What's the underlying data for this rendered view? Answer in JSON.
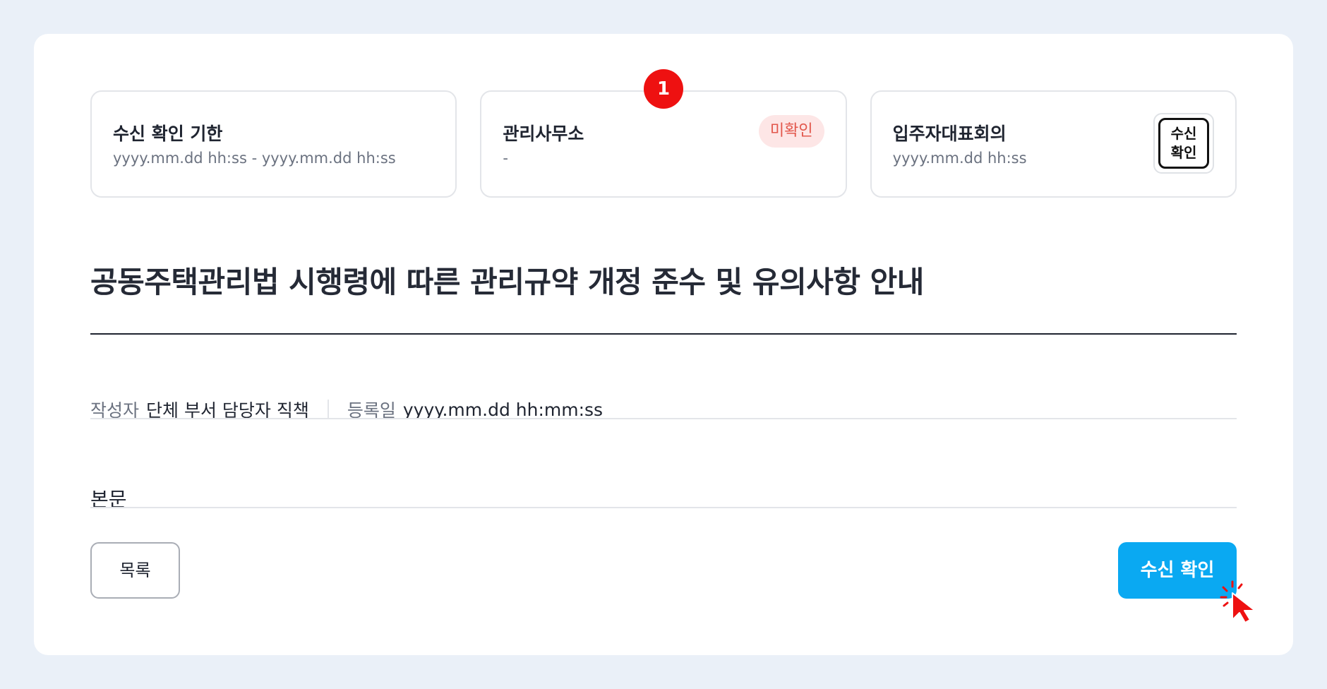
{
  "cards": [
    {
      "title": "수신 확인 기한",
      "subtitle": "yyyy.mm.dd hh:ss  -  yyyy.mm.dd hh:ss"
    },
    {
      "title": "관리사무소",
      "subtitle": "-",
      "status_badge": "미확인",
      "step_number": "1"
    },
    {
      "title": "입주자대표회의",
      "subtitle": "yyyy.mm.dd hh:ss",
      "stamp_line1": "수신",
      "stamp_line2": "확인"
    }
  ],
  "post": {
    "title": "공동주택관리법 시행령에 따른 관리규약 개정 준수 및 유의사항 안내",
    "author_label": "작성자",
    "author_value": "단체 부서 담당자 직책",
    "date_label": "등록일",
    "date_value": "yyyy.mm.dd hh:mm:ss",
    "body": "본문"
  },
  "actions": {
    "list_label": "목록",
    "confirm_label": "수신 확인"
  },
  "colors": {
    "accent": "#0aa9f2",
    "unconfirmed_text": "#e2574c",
    "unconfirmed_bg": "#fde6e6",
    "step_badge": "#ee1111",
    "page_bg": "#eaf0f8"
  },
  "icons": {
    "cursor": "click-cursor-icon"
  }
}
